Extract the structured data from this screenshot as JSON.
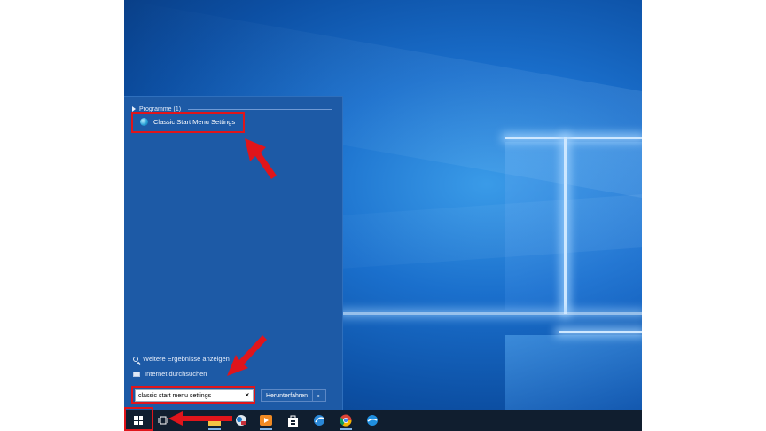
{
  "start_menu": {
    "programs_header": "Programme (1)",
    "program_result": "Classic Start Menu Settings",
    "more_results": "Weitere Ergebnisse anzeigen",
    "search_internet": "Internet durchsuchen",
    "search_value": "classic start menu settings",
    "clear_glyph": "×",
    "shutdown_label": "Herunterfahren",
    "shutdown_arrow": "▸"
  },
  "taskbar": {
    "items": [
      "start-button",
      "task-view",
      "file-explorer",
      "classic-shell",
      "media-player",
      "store",
      "qq-browser",
      "chrome",
      "app-blue"
    ]
  },
  "colors": {
    "annotation": "#e0151b",
    "start_menu_bg": "#1d5aa6",
    "taskbar_bg": "#101e2f"
  }
}
